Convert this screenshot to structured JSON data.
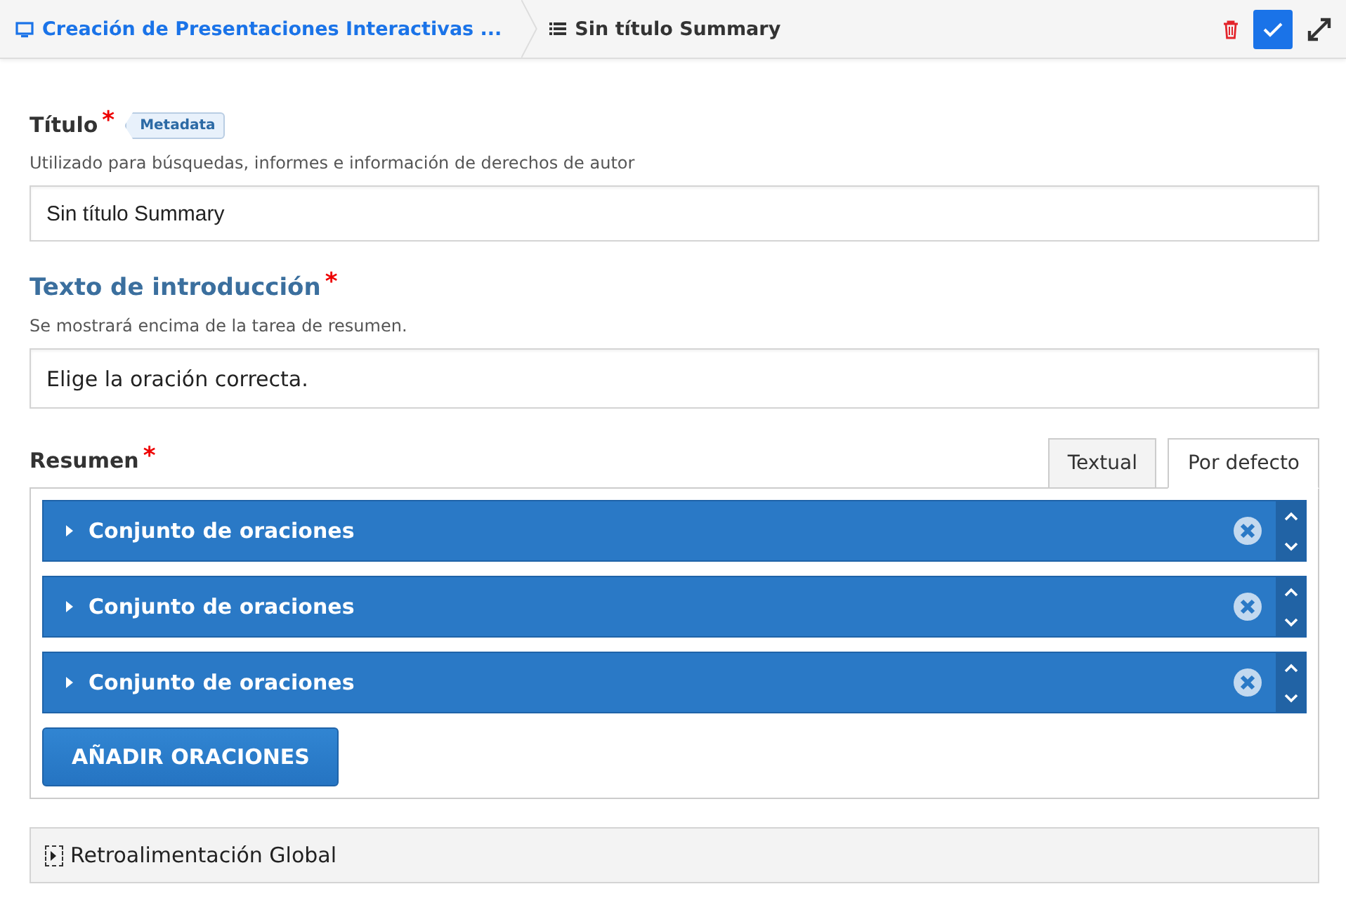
{
  "header": {
    "breadcrumb": "Creación de Presentaciones Interactivas ...",
    "title": "Sin título Summary"
  },
  "title_field": {
    "label": "Título",
    "required_mark": "*",
    "badge": "Metadata",
    "description": "Utilizado para búsquedas, informes e información de derechos de autor",
    "value": "Sin título Summary"
  },
  "intro_field": {
    "label": "Texto de introducción",
    "required_mark": "*",
    "description": "Se mostrará encima de la tarea de resumen.",
    "value": "Elige la oración correcta."
  },
  "summary": {
    "label": "Resumen",
    "required_mark": "*",
    "tabs": [
      {
        "label": "Textual",
        "selected": false
      },
      {
        "label": "Por defecto",
        "selected": true
      }
    ],
    "groups": [
      {
        "label": "Conjunto de oraciones",
        "expanded": false
      },
      {
        "label": "Conjunto de oraciones",
        "expanded": false
      },
      {
        "label": "Conjunto de oraciones",
        "expanded": false
      }
    ],
    "add_button": "AÑADIR ORACIONES"
  },
  "feedback": {
    "label": "Retroalimentación Global",
    "expanded": false
  }
}
